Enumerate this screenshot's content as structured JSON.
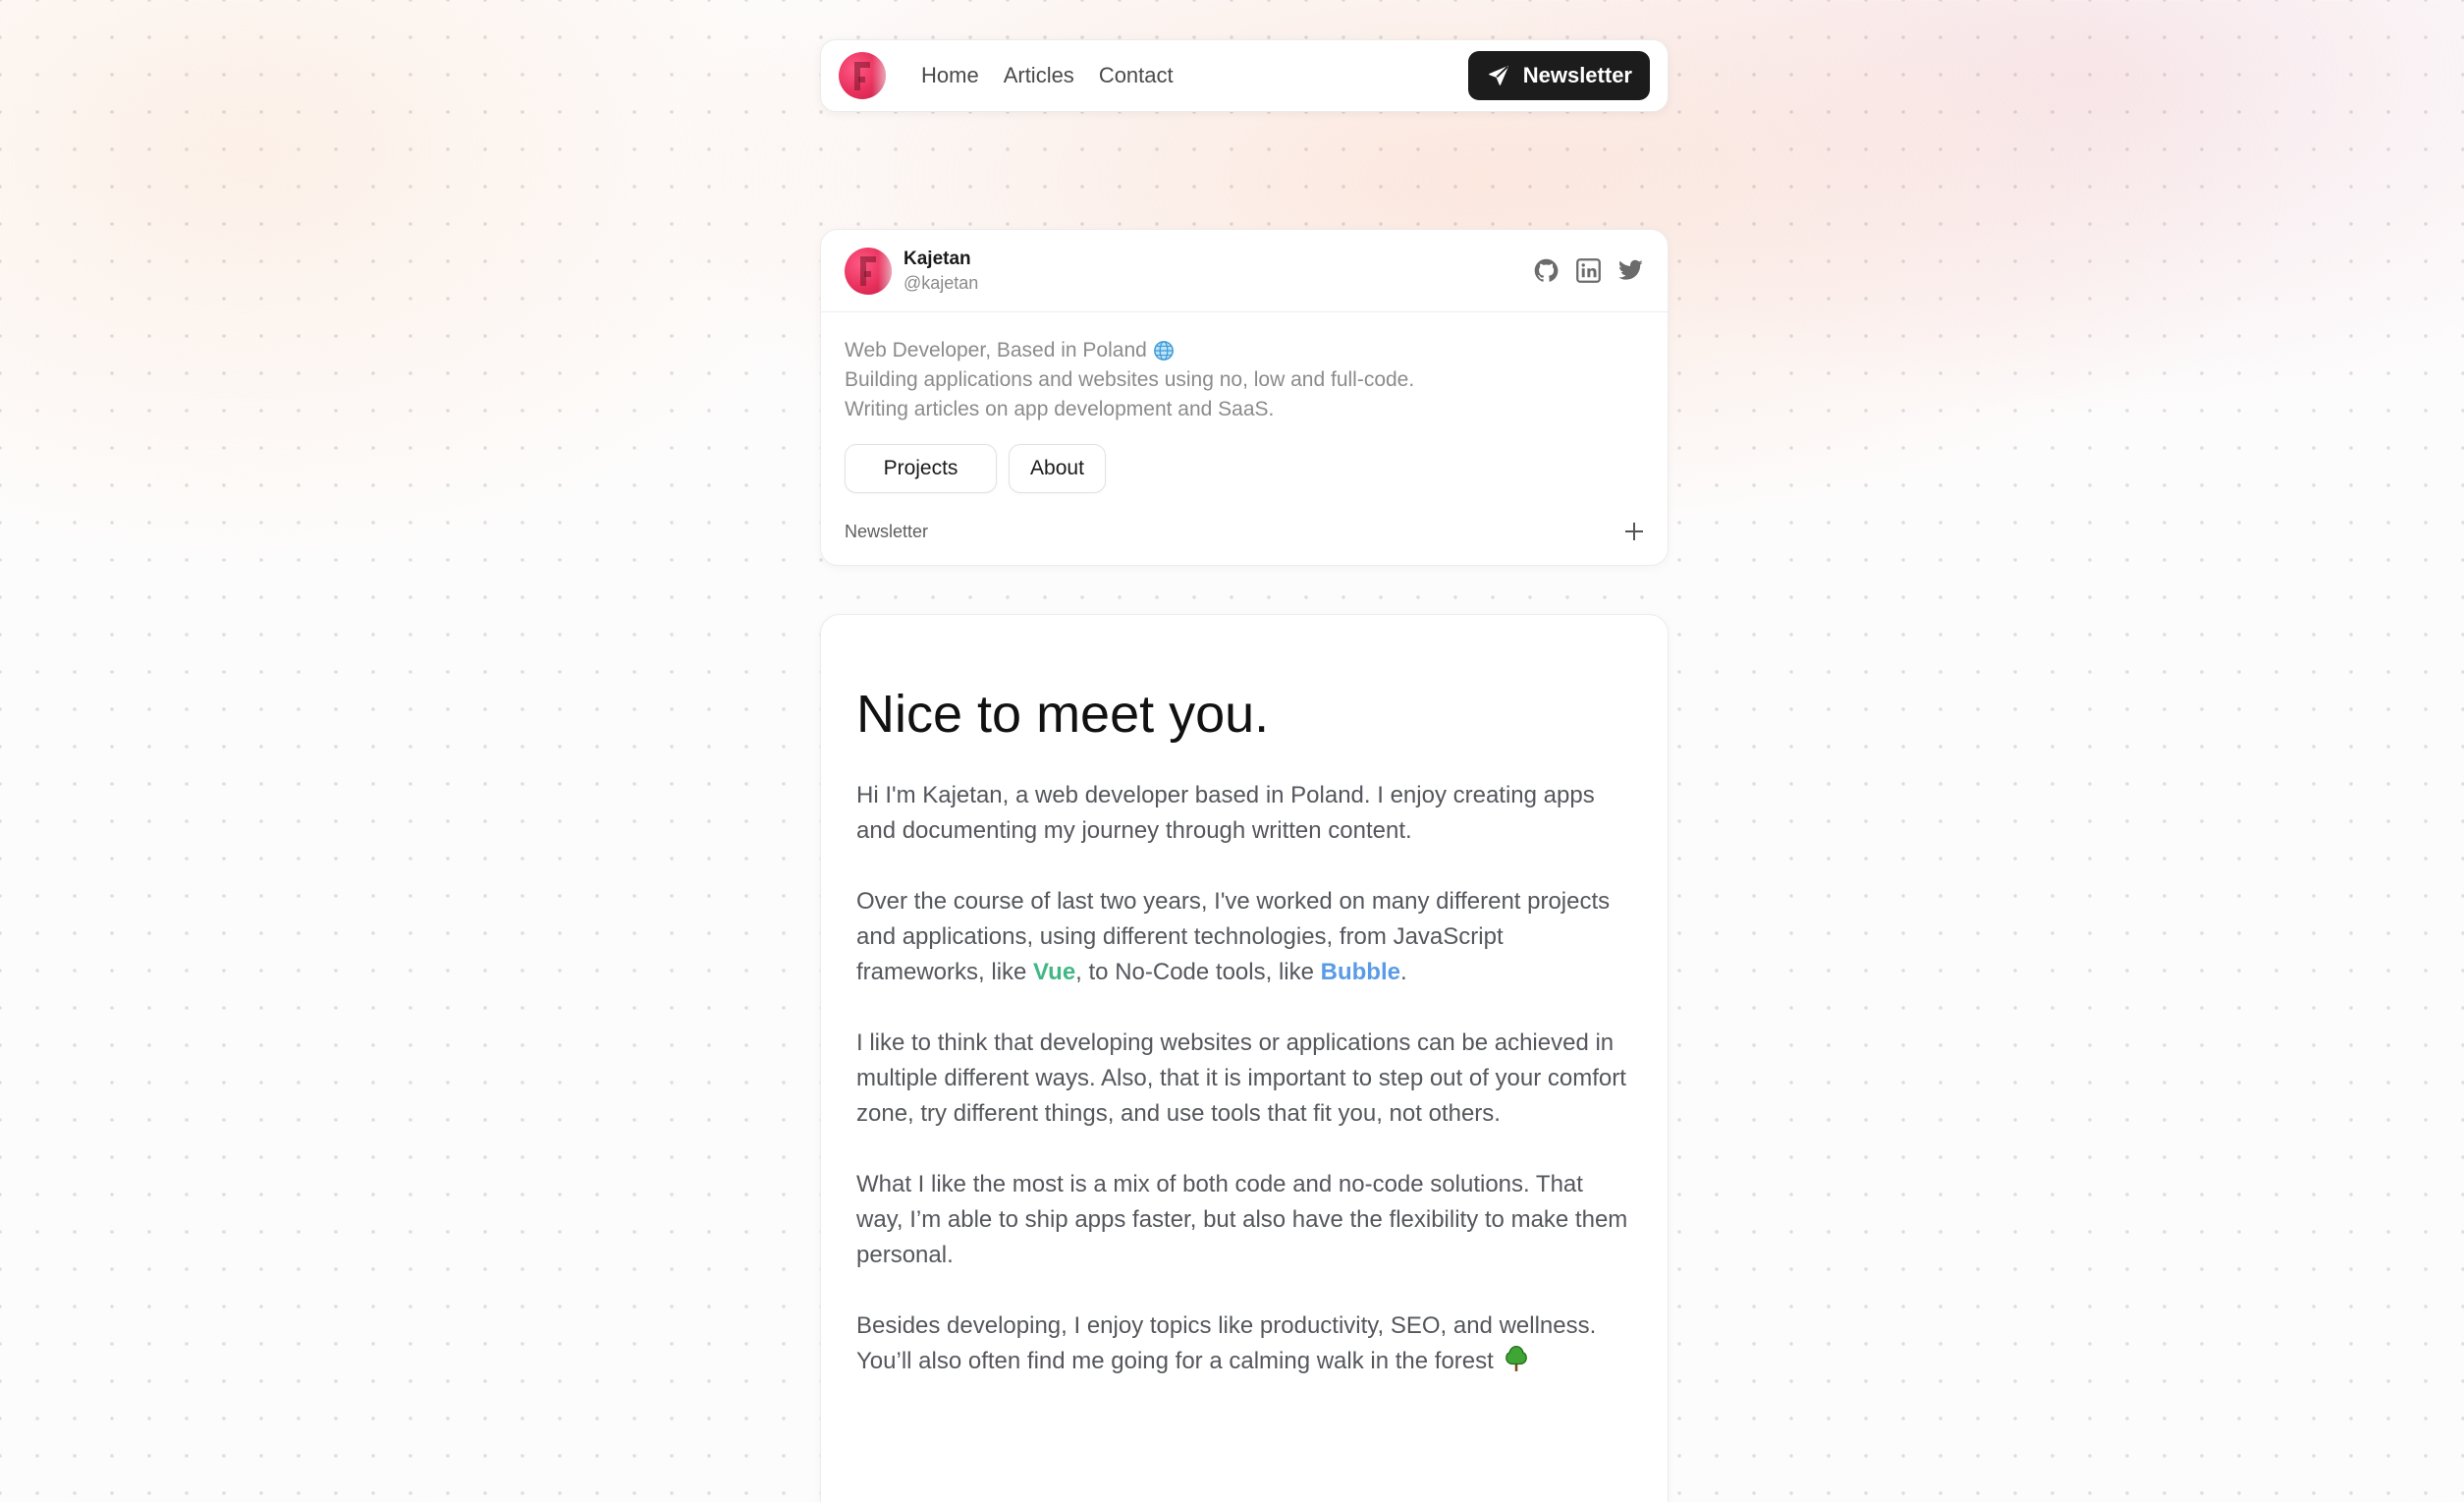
{
  "nav": {
    "links": [
      "Home",
      "Articles",
      "Contact"
    ],
    "newsletter_button": "Newsletter"
  },
  "profile": {
    "name": "Kajetan",
    "handle": "@kajetan",
    "socials": [
      "github-icon",
      "linkedin-icon",
      "twitter-icon"
    ],
    "bio": [
      "Web Developer, Based in Poland",
      "Building applications and websites using no, low and full-code.",
      "Writing articles on app development and SaaS."
    ],
    "buttons": {
      "projects": "Projects",
      "about": "About"
    },
    "accordion_label": "Newsletter"
  },
  "article": {
    "title": "Nice to meet you.",
    "p1": "Hi I'm Kajetan, a web developer based in Poland. I enjoy creating apps and documenting my journey through written content.",
    "p2_before": "Over the course of last two years, I've worked on many different projects and applications, using different technologies, from JavaScript frameworks, like ",
    "p2_vue": "Vue",
    "p2_middle": ", to No-Code tools, like ",
    "p2_bubble": "Bubble",
    "p2_after": ".",
    "p3": "I like to think that developing websites or applications can be achieved in multiple different ways. Also, that it is important to step out of your comfort zone, try different things, and use tools that fit you, not others.",
    "p4": "What I like the most is a mix of both code and no-code solutions. That way, I’m able to ship apps faster, but also have the flexibility to make them personal.",
    "p5": "Besides developing, I enjoy topics like productivity, SEO, and wellness. You’ll also often find me going for a calming walk in the forest"
  },
  "colors": {
    "vue": "#41b883",
    "bubble": "#5a9be6",
    "button_dark": "#1c1c1c",
    "avatar": "#e8305c"
  }
}
